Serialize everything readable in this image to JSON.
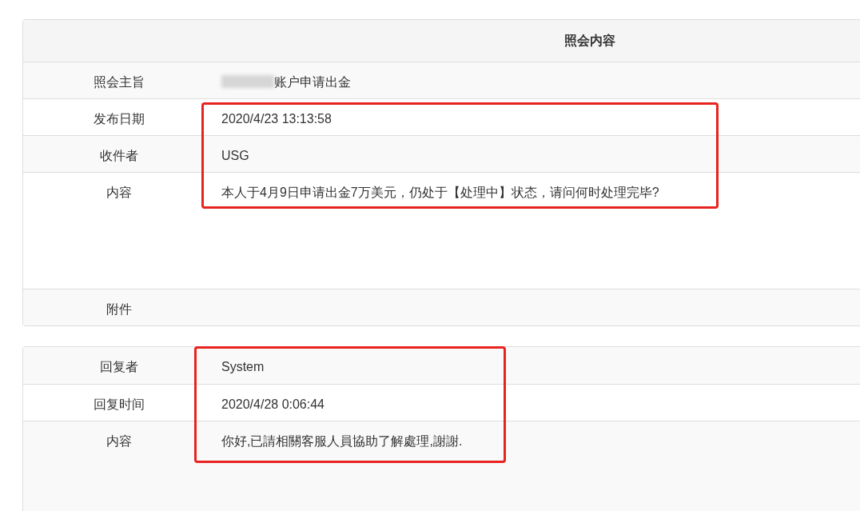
{
  "inquiry": {
    "title": "照会内容",
    "rows": [
      {
        "label": "照会主旨",
        "value": "账户申请出金",
        "kind": "redacted"
      },
      {
        "label": "发布日期",
        "value": "2020/4/23 13:13:58",
        "kind": "plain"
      },
      {
        "label": "收件者",
        "value": "USG",
        "kind": "plain"
      },
      {
        "label": "内容",
        "value": "本人于4月9日申请出金7万美元，仍处于【处理中】状态，请问何时处理完毕?",
        "kind": "long"
      },
      {
        "label": "附件",
        "kind": "plain"
      }
    ]
  },
  "reply": {
    "rows": [
      {
        "label": "回复者",
        "value": "System",
        "kind": "plain"
      },
      {
        "label": "回复时间",
        "value": "2020/4/28 0:06:44",
        "kind": "plain"
      },
      {
        "label": "内容",
        "value": "你好,已請相關客服人員協助了解處理,謝謝.",
        "kind": "long"
      }
    ]
  }
}
